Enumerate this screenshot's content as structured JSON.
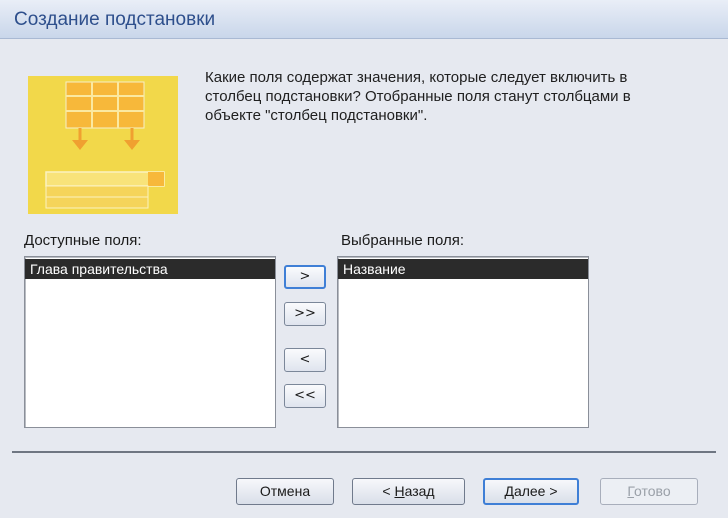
{
  "window": {
    "title": "Создание подстановки"
  },
  "prompt": {
    "line1": "Какие поля содержат значения, которые следует включить в",
    "line2": "столбец подстановки? Отобранные поля станут столбцами в",
    "line3": "объекте \"столбец подстановки\"."
  },
  "available_fields": {
    "label": "Доступные поля:",
    "items": [
      "Глава правительства"
    ]
  },
  "selected_fields": {
    "label": "Выбранные поля:",
    "items": [
      "Название"
    ]
  },
  "move_buttons": {
    "add": ">",
    "add_all": ">>",
    "remove": "<",
    "remove_all": "<<"
  },
  "footer": {
    "cancel": "Отмена",
    "back_prefix": "< ",
    "back_accel": "Н",
    "back_rest": "азад",
    "next_accel": "Д",
    "next_rest": "алее >",
    "finish_accel": "Г",
    "finish_rest": "отово"
  },
  "colors": {
    "title_text": "#2e4f8c",
    "wizard_image": "#f2d84a",
    "selection": "#2b2b2b",
    "focus": "#3f7fd6"
  }
}
